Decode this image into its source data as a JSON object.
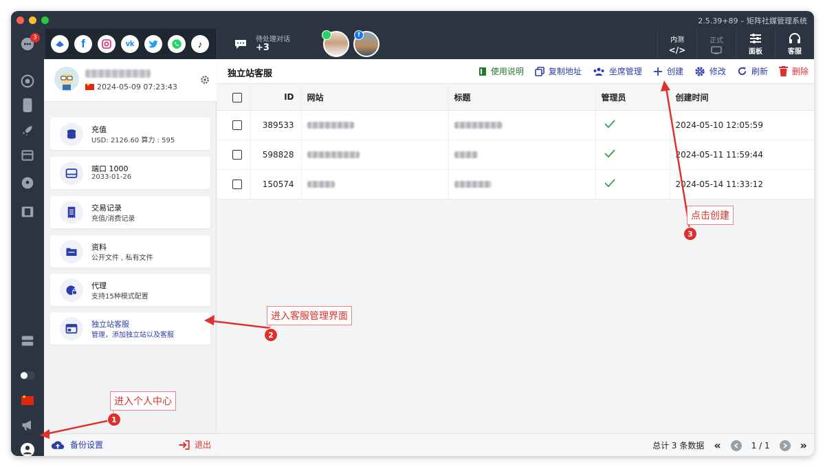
{
  "window": {
    "title": "2.5.39+89 – 矩阵社媒管理系统"
  },
  "rail": {
    "badge_count": "3"
  },
  "topbar": {
    "socials": [
      "linkedin-style",
      "facebook",
      "instagram",
      "vk",
      "twitter",
      "whatsapp",
      "tiktok"
    ],
    "pending_label": "待处理对话",
    "pending_count": "+3",
    "buttons": {
      "internal_label_top": "内测",
      "formal_label_top": "正式",
      "panel_label": "面板",
      "service_label": "客服"
    }
  },
  "profile": {
    "date": "2024-05-09 07:23:43"
  },
  "cards": [
    {
      "title": "充值",
      "sub": "USD: 2126.60  算力 : 595",
      "icon": "coins-icon"
    },
    {
      "title": "端口 1000",
      "sub": "2033-01-26",
      "icon": "port-icon"
    },
    {
      "title": "交易记录",
      "sub": "充值/消费记录",
      "icon": "receipt-icon"
    },
    {
      "title": "资料",
      "sub": "公开文件 , 私有文件",
      "icon": "folder-icon"
    },
    {
      "title": "代理",
      "sub": "支持15种模式配置",
      "icon": "proxy-icon"
    },
    {
      "title": "独立站客服",
      "sub": "管理，添加独立站以及客服",
      "icon": "site-icon"
    }
  ],
  "panel_footer": {
    "backup": "备份设置",
    "logout": "退出"
  },
  "main": {
    "title": "独立站客服",
    "actions": {
      "help": "使用说明",
      "copy": "复制地址",
      "seats": "坐席管理",
      "create": "创建",
      "edit": "修改",
      "refresh": "刷新",
      "delete": "删除"
    },
    "columns": [
      "ID",
      "网站",
      "标题",
      "管理员",
      "创建时间"
    ],
    "rows": [
      {
        "id": "389533",
        "created": "2024-05-10 12:05:59"
      },
      {
        "id": "598828",
        "created": "2024-05-11 11:59:44"
      },
      {
        "id": "150574",
        "created": "2024-05-14 11:33:12"
      }
    ],
    "footer": {
      "total": "总计 3 条数据",
      "page": "1 / 1"
    }
  },
  "annotations": {
    "n1": "1",
    "t1": "进入个人中心",
    "n2": "2",
    "t2": "进入客服管理界面",
    "n3": "3",
    "t3": "点击创建"
  },
  "colors": {
    "accent": "#2b3ea8",
    "dark": "#2b3440",
    "red": "#e0302c",
    "green": "#1f7a2e"
  }
}
